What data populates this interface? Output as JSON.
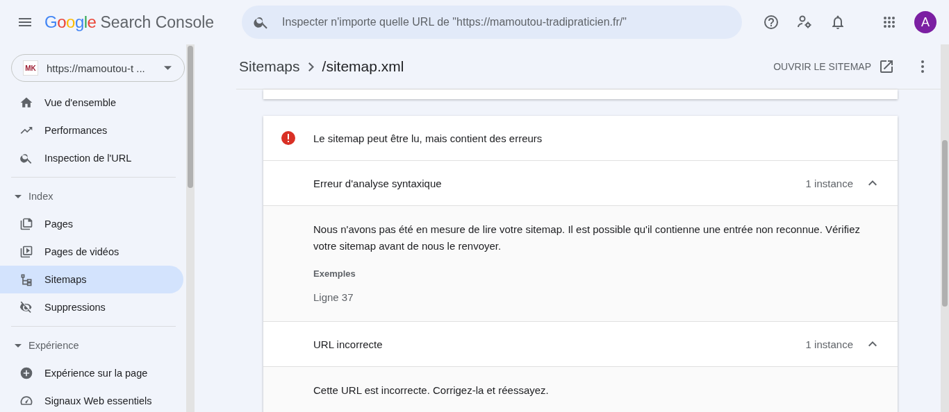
{
  "header": {
    "product": "Search Console",
    "brand": "Google",
    "search": {
      "placeholder": "Inspecter n'importe quelle URL de \"https://mamoutou-tradipraticien.fr/\""
    },
    "avatar": "A"
  },
  "property": {
    "badge": "MK",
    "label": "https://mamoutou-t ..."
  },
  "sidebar": {
    "items": [
      {
        "kind": "link",
        "label": "Vue d'ensemble",
        "selected": false
      },
      {
        "kind": "link",
        "label": "Performances",
        "selected": false
      },
      {
        "kind": "link",
        "label": "Inspection de l'URL",
        "selected": false
      },
      {
        "kind": "section",
        "label": "Index",
        "expanded": true,
        "children": [
          {
            "label": "Pages",
            "selected": false
          },
          {
            "label": "Pages de vidéos",
            "selected": false
          },
          {
            "label": "Sitemaps",
            "selected": true
          },
          {
            "label": "Suppressions",
            "selected": false
          }
        ]
      },
      {
        "kind": "section",
        "label": "Expérience",
        "expanded": true,
        "children": [
          {
            "label": "Expérience sur la page",
            "selected": false
          },
          {
            "label": "Signaux Web essentiels",
            "selected": false
          }
        ]
      }
    ]
  },
  "breadcrumb": {
    "parent": "Sitemaps",
    "current": "/sitemap.xml"
  },
  "open_button": "OUVRIR LE SITEMAP",
  "status": {
    "message": "Le sitemap peut être lu, mais contient des erreurs"
  },
  "errors": [
    {
      "title": "Erreur d'analyse syntaxique",
      "count": "1 instance",
      "expanded": true,
      "description": "Nous n'avons pas été en mesure de lire votre sitemap. Il est possible qu'il contienne une entrée non reconnue. Vérifiez votre sitemap avant de nous le renvoyer.",
      "examples_label": "Exemples",
      "example": "Ligne 37"
    },
    {
      "title": "URL incorrecte",
      "count": "1 instance",
      "expanded": true,
      "description": "Cette URL est incorrecte. Corrigez-la et réessayez."
    }
  ]
}
